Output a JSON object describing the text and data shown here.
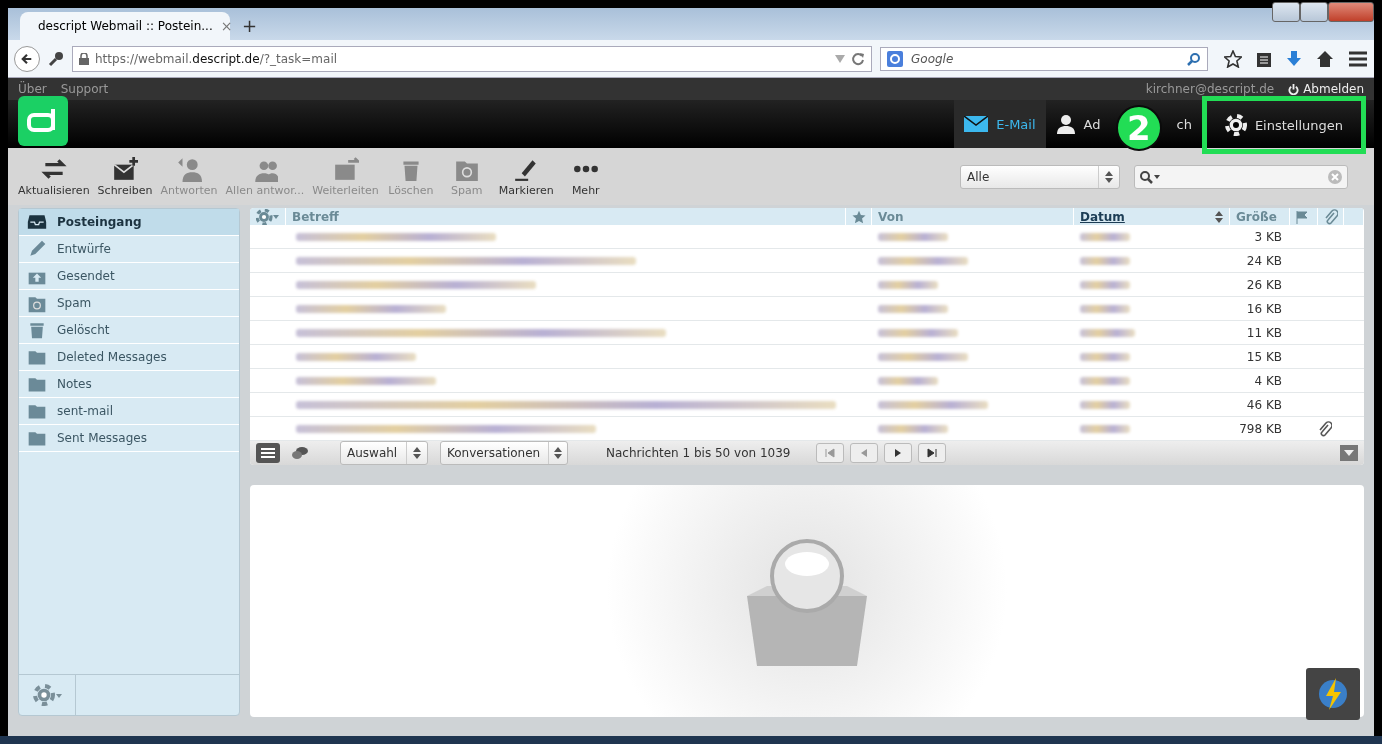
{
  "browser": {
    "tab_title": "descript Webmail :: Postein...",
    "tab_close": "×",
    "new_tab": "+",
    "url_prefix": "https://webmail.",
    "url_domain": "descript.de",
    "url_suffix": "/?_task=mail",
    "search_placeholder": "Google"
  },
  "topbar": {
    "links": [
      "Über",
      "Support"
    ],
    "user": "kirchner@descript.de",
    "logout": "Abmelden"
  },
  "nav": [
    {
      "kind": "mail",
      "label": "E-Mail",
      "selected": true
    },
    {
      "kind": "contacts",
      "label": "Ad",
      "label_tail": "ch",
      "selected": false
    },
    {
      "kind": "settings",
      "label": "Einstellungen",
      "selected": false
    }
  ],
  "annotation": {
    "number": "2"
  },
  "toolbar": [
    {
      "kind": "refresh",
      "label": "Aktualisieren",
      "disabled": false
    },
    {
      "kind": "compose",
      "label": "Schreiben",
      "disabled": false
    },
    {
      "kind": "reply",
      "label": "Antworten",
      "disabled": true
    },
    {
      "kind": "replyall",
      "label": "Allen antwor...",
      "disabled": true
    },
    {
      "kind": "forward",
      "label": "Weiterleiten",
      "disabled": true
    },
    {
      "kind": "delete",
      "label": "Löschen",
      "disabled": true
    },
    {
      "kind": "spam",
      "label": "Spam",
      "disabled": true
    },
    {
      "kind": "mark",
      "label": "Markieren",
      "disabled": false
    },
    {
      "kind": "more",
      "label": "Mehr",
      "disabled": false
    }
  ],
  "filter": {
    "value": "Alle"
  },
  "folders": [
    {
      "kind": "inbox",
      "label": "Posteingang",
      "selected": true
    },
    {
      "kind": "drafts",
      "label": "Entwürfe",
      "selected": false
    },
    {
      "kind": "sent",
      "label": "Gesendet",
      "selected": false
    },
    {
      "kind": "spam",
      "label": "Spam",
      "selected": false
    },
    {
      "kind": "trash",
      "label": "Gelöscht",
      "selected": false
    },
    {
      "kind": "folder",
      "label": "Deleted Messages",
      "selected": false
    },
    {
      "kind": "folder",
      "label": "Notes",
      "selected": false
    },
    {
      "kind": "folder",
      "label": "sent-mail",
      "selected": false
    },
    {
      "kind": "folder",
      "label": "Sent Messages",
      "selected": false
    }
  ],
  "table": {
    "columns": {
      "subject": "Betreff",
      "from": "Von",
      "date": "Datum",
      "size": "Größe"
    },
    "rows": [
      {
        "size": "3 KB",
        "attachment": false
      },
      {
        "size": "24 KB",
        "attachment": false
      },
      {
        "size": "26 KB",
        "attachment": false
      },
      {
        "size": "16 KB",
        "attachment": false
      },
      {
        "size": "11 KB",
        "attachment": false
      },
      {
        "size": "15 KB",
        "attachment": false
      },
      {
        "size": "4 KB",
        "attachment": false
      },
      {
        "size": "46 KB",
        "attachment": false
      },
      {
        "size": "798 KB",
        "attachment": true
      }
    ]
  },
  "list_footer": {
    "selection": "Auswahl",
    "threads": "Konversationen",
    "count": "Nachrichten 1 bis 50 von 1039"
  }
}
